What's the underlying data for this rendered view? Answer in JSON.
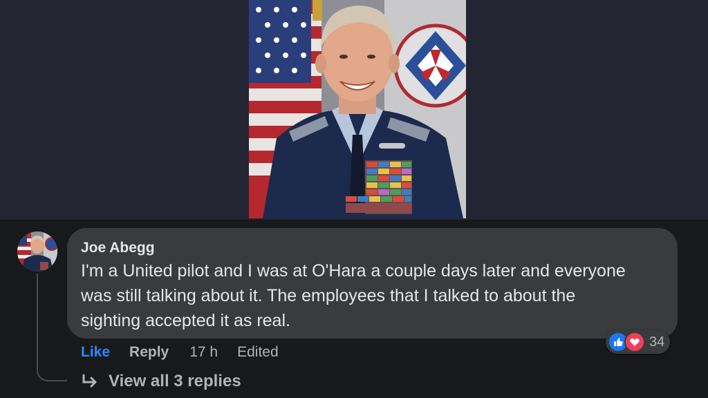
{
  "post": {
    "image_alt": "Portrait photo of a man in a Civil Air Patrol uniform in front of flags"
  },
  "comment": {
    "author": "Joe Abegg",
    "text": "I'm a United pilot and I was at O'Hara a couple days later and everyone\nwas still talking about it. The employees that I talked to about the\nsighting accepted it as real.",
    "actions": {
      "like": "Like",
      "reply": "Reply",
      "time": "17 h",
      "edited": "Edited"
    },
    "reactions": {
      "icons": [
        "like-icon",
        "love-icon"
      ],
      "count": "34"
    },
    "view_replies": "View all 3 replies"
  },
  "colors": {
    "background": "#18191a",
    "bubble": "#3a3b3c",
    "link_blue": "#2d88ff",
    "secondary_text": "#b0b3b8",
    "primary_text": "#e4e6eb"
  }
}
